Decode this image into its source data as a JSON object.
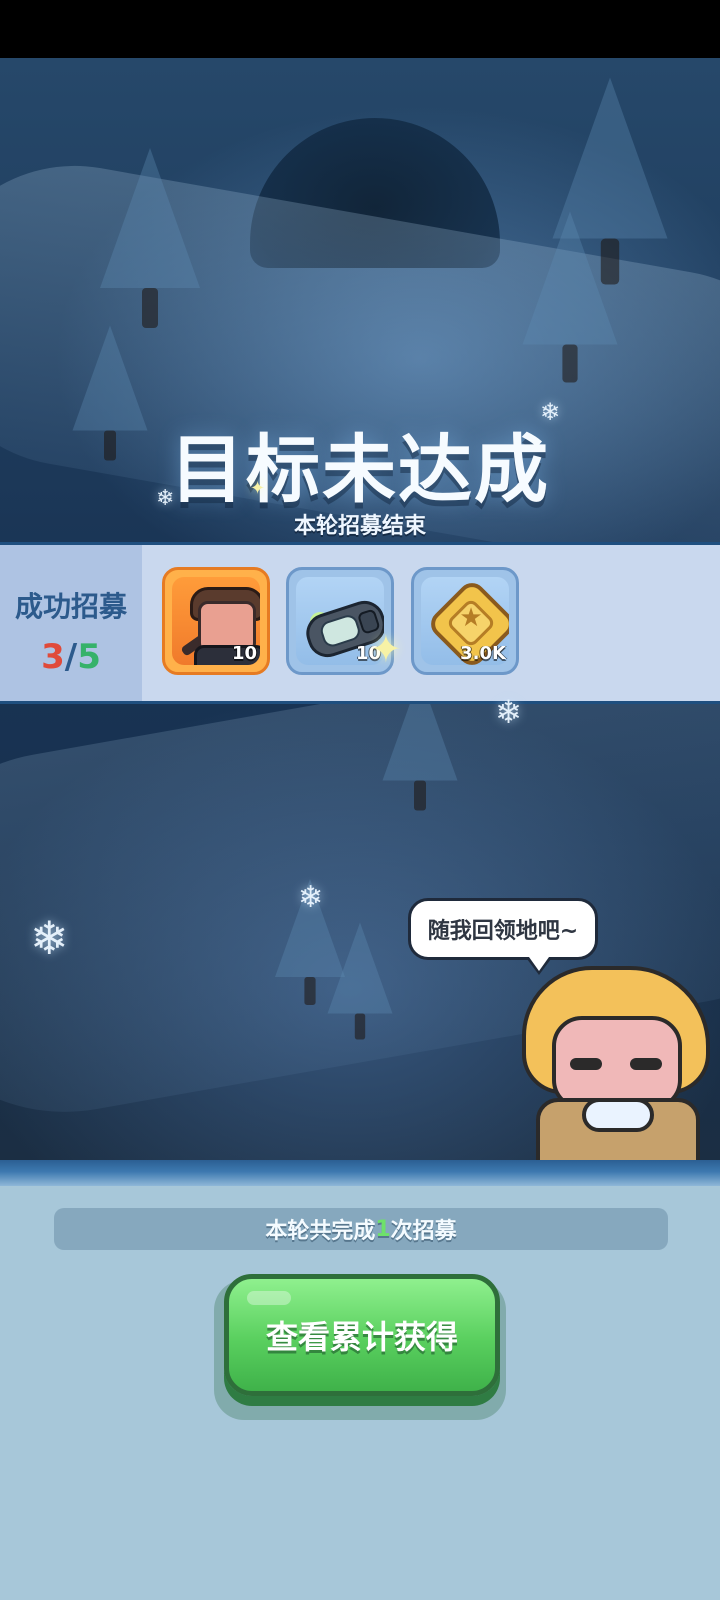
{
  "game": {
    "title": "目标未达成",
    "subtitle": "本轮招募结束",
    "rewards_panel": {
      "label": "成功招募",
      "progress": {
        "current": "3",
        "separator": "/",
        "total": "5"
      },
      "items": [
        {
          "name": "hero-card",
          "quantity": "10"
        },
        {
          "name": "capsule-item",
          "quantity": "10"
        },
        {
          "name": "gold-coin",
          "quantity": "3.0K"
        }
      ]
    },
    "npc_dialogue": "随我回领地吧~",
    "summary": {
      "prefix": "本轮共完成",
      "count": "1",
      "suffix": "次招募"
    },
    "primary_button": {
      "label": "查看累计获得"
    }
  }
}
